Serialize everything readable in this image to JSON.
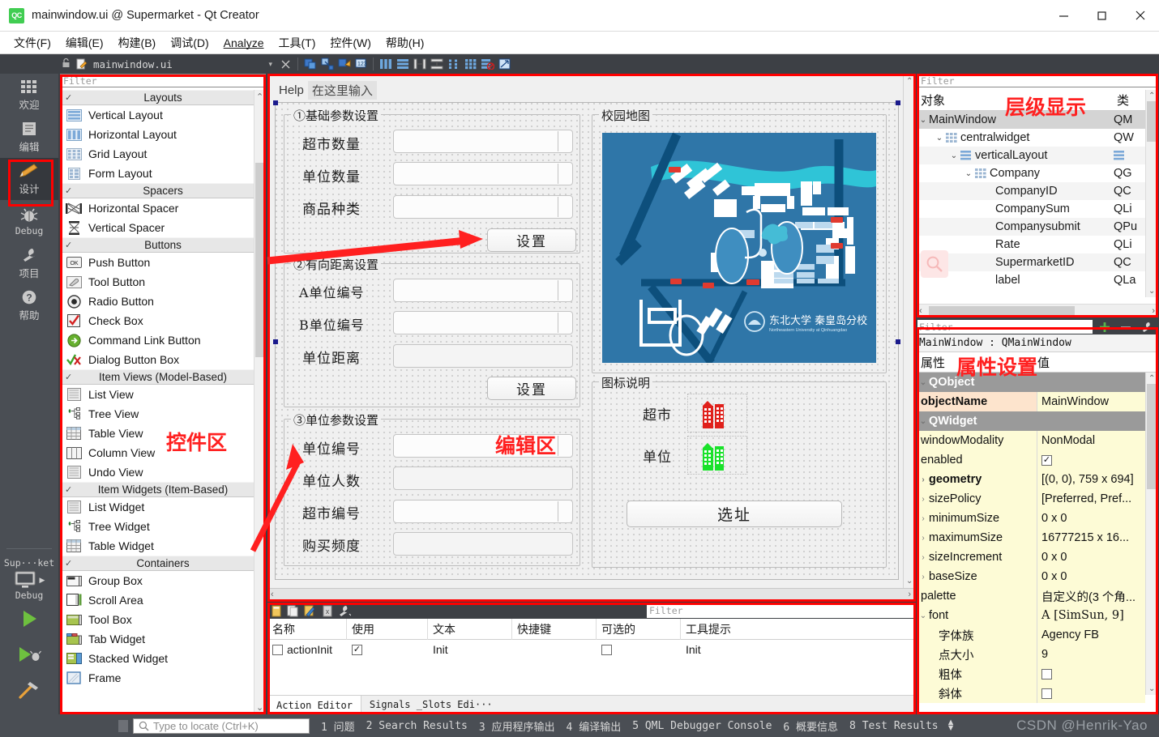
{
  "window": {
    "title": "mainwindow.ui @ Supermarket - Qt Creator",
    "logo_text": "QC",
    "minimize": "minimize-button",
    "maximize": "maximize-button",
    "close": "close-button"
  },
  "menubar": {
    "items": [
      {
        "label": "文件(F)",
        "mn": "F"
      },
      {
        "label": "编辑(E)",
        "mn": "E"
      },
      {
        "label": "构建(B)",
        "mn": "B"
      },
      {
        "label": "调试(D)",
        "mn": "D"
      },
      {
        "label": "Analyze",
        "mn": "A"
      },
      {
        "label": "工具(T)",
        "mn": "T"
      },
      {
        "label": "控件(W)",
        "mn": "W"
      },
      {
        "label": "帮助(H)",
        "mn": "H"
      }
    ]
  },
  "editor_toolbar": {
    "filename": "mainwindow.ui",
    "dropdown_caret": "▾",
    "close_label": "✕"
  },
  "modebar": {
    "items": [
      {
        "label": "欢迎",
        "icon": "grid-icon",
        "active": false
      },
      {
        "label": "编辑",
        "icon": "document-icon",
        "active": false
      },
      {
        "label": "设计",
        "icon": "pencil-icon",
        "active": true
      },
      {
        "label": "Debug",
        "icon": "bug-icon",
        "active": false,
        "latin": true
      },
      {
        "label": "项目",
        "icon": "wrench-icon",
        "active": false
      },
      {
        "label": "帮助",
        "icon": "question-icon",
        "active": false
      }
    ],
    "kit_name": "Sup···ket",
    "kit_mode": "Debug",
    "run_buttons": [
      "run-icon",
      "debug-run-icon",
      "build-hammer-icon"
    ]
  },
  "widget_box": {
    "filter_placeholder": "Filter",
    "sections": [
      {
        "title": "Layouts",
        "items": [
          {
            "label": "Vertical Layout",
            "icon": "vertical-layout-icon"
          },
          {
            "label": "Horizontal Layout",
            "icon": "horizontal-layout-icon"
          },
          {
            "label": "Grid Layout",
            "icon": "grid-layout-icon"
          },
          {
            "label": "Form Layout",
            "icon": "form-layout-icon"
          }
        ]
      },
      {
        "title": "Spacers",
        "items": [
          {
            "label": "Horizontal Spacer",
            "icon": "horizontal-spacer-icon"
          },
          {
            "label": "Vertical Spacer",
            "icon": "vertical-spacer-icon"
          }
        ]
      },
      {
        "title": "Buttons",
        "items": [
          {
            "label": "Push Button",
            "icon": "push-button-icon"
          },
          {
            "label": "Tool Button",
            "icon": "tool-button-icon"
          },
          {
            "label": "Radio Button",
            "icon": "radio-button-icon"
          },
          {
            "label": "Check Box",
            "icon": "check-box-icon"
          },
          {
            "label": "Command Link Button",
            "icon": "command-link-icon"
          },
          {
            "label": "Dialog Button Box",
            "icon": "dialog-button-box-icon"
          }
        ]
      },
      {
        "title": "Item Views (Model-Based)",
        "items": [
          {
            "label": "List View",
            "icon": "list-view-icon"
          },
          {
            "label": "Tree View",
            "icon": "tree-view-icon"
          },
          {
            "label": "Table View",
            "icon": "table-view-icon"
          },
          {
            "label": "Column View",
            "icon": "column-view-icon"
          },
          {
            "label": "Undo View",
            "icon": "undo-view-icon"
          }
        ]
      },
      {
        "title": "Item Widgets (Item-Based)",
        "items": [
          {
            "label": "List Widget",
            "icon": "list-widget-icon"
          },
          {
            "label": "Tree Widget",
            "icon": "tree-widget-icon"
          },
          {
            "label": "Table Widget",
            "icon": "table-widget-icon"
          }
        ]
      },
      {
        "title": "Containers",
        "items": [
          {
            "label": "Group Box",
            "icon": "group-box-icon"
          },
          {
            "label": "Scroll Area",
            "icon": "scroll-area-icon"
          },
          {
            "label": "Tool Box",
            "icon": "tool-box-icon"
          },
          {
            "label": "Tab Widget",
            "icon": "tab-widget-icon"
          },
          {
            "label": "Stacked Widget",
            "icon": "stacked-widget-icon"
          },
          {
            "label": "Frame",
            "icon": "frame-icon"
          }
        ]
      }
    ]
  },
  "form": {
    "menu_help": "Help",
    "menu_placeholder": "在这里输入",
    "group1_title": "①基础参数设置",
    "group1_fields": [
      "超市数量",
      "单位数量",
      "商品种类"
    ],
    "group1_button": "设置",
    "group2_title": "②有向距离设置",
    "group2_fields": [
      "A单位编号",
      "B单位编号",
      "单位距离"
    ],
    "group2_button": "设置",
    "group3_title": "③单位参数设置",
    "group3_fields": [
      "单位编号",
      "单位人数",
      "超市编号",
      "购买频度"
    ],
    "map_group_title": "校园地图",
    "map_watermark_cn": "东北大学 秦皇岛分校",
    "map_watermark_en": "Northeastern University at Qinhuangdao",
    "legend_title": "图标说明",
    "legend_items": [
      {
        "label": "超市",
        "color": "#e0201b",
        "icon": "building-icon"
      },
      {
        "label": "单位",
        "color": "#19e22a",
        "icon": "building-icon"
      }
    ],
    "site_button": "选址"
  },
  "action_editor": {
    "filter_placeholder": "Filter",
    "columns": [
      "名称",
      "使用",
      "文本",
      "快捷键",
      "可选的",
      "工具提示"
    ],
    "rows": [
      {
        "name": "actionInit",
        "used": true,
        "text": "Init",
        "shortcut": "",
        "checkable": false,
        "tooltip": "Init"
      }
    ],
    "tabs": [
      {
        "label": "Action Editor",
        "active": true
      },
      {
        "label": "Signals _Slots Edi···",
        "active": false
      }
    ],
    "toolbar_icons": [
      "new-icon",
      "copy-icon",
      "edit-icon",
      "delete-icon",
      "config-icon"
    ]
  },
  "object_tree": {
    "filter_placeholder": "Filter",
    "columns": [
      "对象",
      "类"
    ],
    "rows": [
      {
        "name": "MainWindow",
        "class": "QM",
        "depth": 0,
        "expanded": true,
        "icon": "",
        "selected": true
      },
      {
        "name": "centralwidget",
        "class": "QW",
        "depth": 1,
        "expanded": true,
        "icon": "grid-layout-icon",
        "selected": false
      },
      {
        "name": "verticalLayout",
        "class": "",
        "depth": 2,
        "expanded": true,
        "icon": "vertical-layout-icon",
        "selected": false
      },
      {
        "name": "Company",
        "class": "QG",
        "depth": 3,
        "expanded": true,
        "icon": "grid-layout-icon",
        "selected": false
      },
      {
        "name": "CompanyID",
        "class": "QC",
        "depth": 4,
        "expanded": null,
        "icon": "",
        "selected": false
      },
      {
        "name": "CompanySum",
        "class": "QLi",
        "depth": 4,
        "expanded": null,
        "icon": "",
        "selected": false
      },
      {
        "name": "Companysubmit",
        "class": "QPu",
        "depth": 4,
        "expanded": null,
        "icon": "",
        "selected": false
      },
      {
        "name": "Rate",
        "class": "QLi",
        "depth": 4,
        "expanded": null,
        "icon": "",
        "selected": false
      },
      {
        "name": "SupermarketID",
        "class": "QC",
        "depth": 4,
        "expanded": null,
        "icon": "",
        "selected": false
      },
      {
        "name": "label",
        "class": "QLa",
        "depth": 4,
        "expanded": null,
        "icon": "",
        "selected": false
      }
    ]
  },
  "property_editor": {
    "filter_placeholder": "Filter",
    "object_line": "MainWindow : QMainWindow",
    "columns": [
      "属性",
      "值"
    ],
    "toolbar_icons": [
      "add-icon",
      "remove-icon",
      "configure-icon"
    ],
    "rows": [
      {
        "kind": "group",
        "name": "QObject"
      },
      {
        "kind": "prop",
        "name": "objectName",
        "value": "MainWindow",
        "bold": true,
        "highlight": "orange"
      },
      {
        "kind": "group",
        "name": "QWidget"
      },
      {
        "kind": "prop",
        "name": "windowModality",
        "value": "NonModal"
      },
      {
        "kind": "prop",
        "name": "enabled",
        "value": "",
        "checkbox": true,
        "checked": true
      },
      {
        "kind": "prop",
        "name": "geometry",
        "value": "[(0, 0), 759 x 694]",
        "bold": true,
        "expandable": true
      },
      {
        "kind": "prop",
        "name": "sizePolicy",
        "value": "[Preferred, Pref...",
        "expandable": true
      },
      {
        "kind": "prop",
        "name": "minimumSize",
        "value": "0 x 0",
        "expandable": true
      },
      {
        "kind": "prop",
        "name": "maximumSize",
        "value": "16777215 x 16...",
        "expandable": true
      },
      {
        "kind": "prop",
        "name": "sizeIncrement",
        "value": "0 x 0",
        "expandable": true
      },
      {
        "kind": "prop",
        "name": "baseSize",
        "value": "0 x 0",
        "expandable": true
      },
      {
        "kind": "prop",
        "name": "palette",
        "value": "自定义的(3 个角..."
      },
      {
        "kind": "prop",
        "name": "font",
        "value": "A  [SimSun, 9]",
        "expanded": true
      },
      {
        "kind": "prop",
        "name": "字体族",
        "value": "Agency FB",
        "indent": true
      },
      {
        "kind": "prop",
        "name": "点大小",
        "value": "9",
        "indent": true
      },
      {
        "kind": "prop",
        "name": "粗体",
        "value": "",
        "indent": true,
        "checkbox": true,
        "checked": false
      },
      {
        "kind": "prop",
        "name": "斜体",
        "value": "",
        "indent": true,
        "checkbox": true,
        "checked": false
      }
    ]
  },
  "statusbar": {
    "locator_placeholder": "Type to locate (Ctrl+K)",
    "items": [
      "1 问题",
      "2 Search Results",
      "3 应用程序输出",
      "4 编译输出",
      "5 QML Debugger Console",
      "6 概要信息",
      "8 Test Results"
    ],
    "watermark": "CSDN @Henrik-Yao"
  },
  "annotations": [
    {
      "text": "编辑区",
      "color": "#ff2020"
    },
    {
      "text": "控件区",
      "color": "#ff2020"
    },
    {
      "text": "层级显示",
      "color": "#ff2020"
    },
    {
      "text": "属性设置",
      "color": "#ff2020"
    }
  ]
}
